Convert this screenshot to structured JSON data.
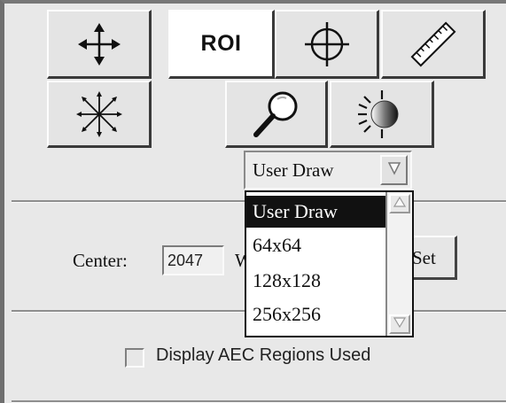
{
  "toolbar": {
    "row1": [
      {
        "name": "pan-tool",
        "icon": "move-arrows-icon"
      },
      {
        "name": "roi-tool",
        "label": "ROI",
        "active": true
      },
      {
        "name": "crosshair-tool",
        "icon": "crosshair-icon"
      },
      {
        "name": "measure-tool",
        "icon": "ruler-icon"
      }
    ],
    "row2": [
      {
        "name": "zoom-out-tool",
        "icon": "starburst-icon"
      },
      {
        "name": "magnify-tool",
        "icon": "magnifier-icon"
      },
      {
        "name": "brightness-tool",
        "icon": "brightness-icon"
      }
    ]
  },
  "roi_select": {
    "value": "User Draw",
    "options": [
      "User Draw",
      "64x64",
      "128x128",
      "256x256"
    ],
    "selected_index": 0
  },
  "window_level": {
    "center_label": "Center:",
    "center_value": "2047",
    "width_label_visible": "W",
    "set_label": "Set"
  },
  "aec": {
    "checkbox_label": "Display AEC Regions Used",
    "checked": false
  },
  "colors": {
    "background": "#e6e6e6",
    "selected_option_bg": "#111111",
    "active_tool_bg": "#ffffff"
  }
}
